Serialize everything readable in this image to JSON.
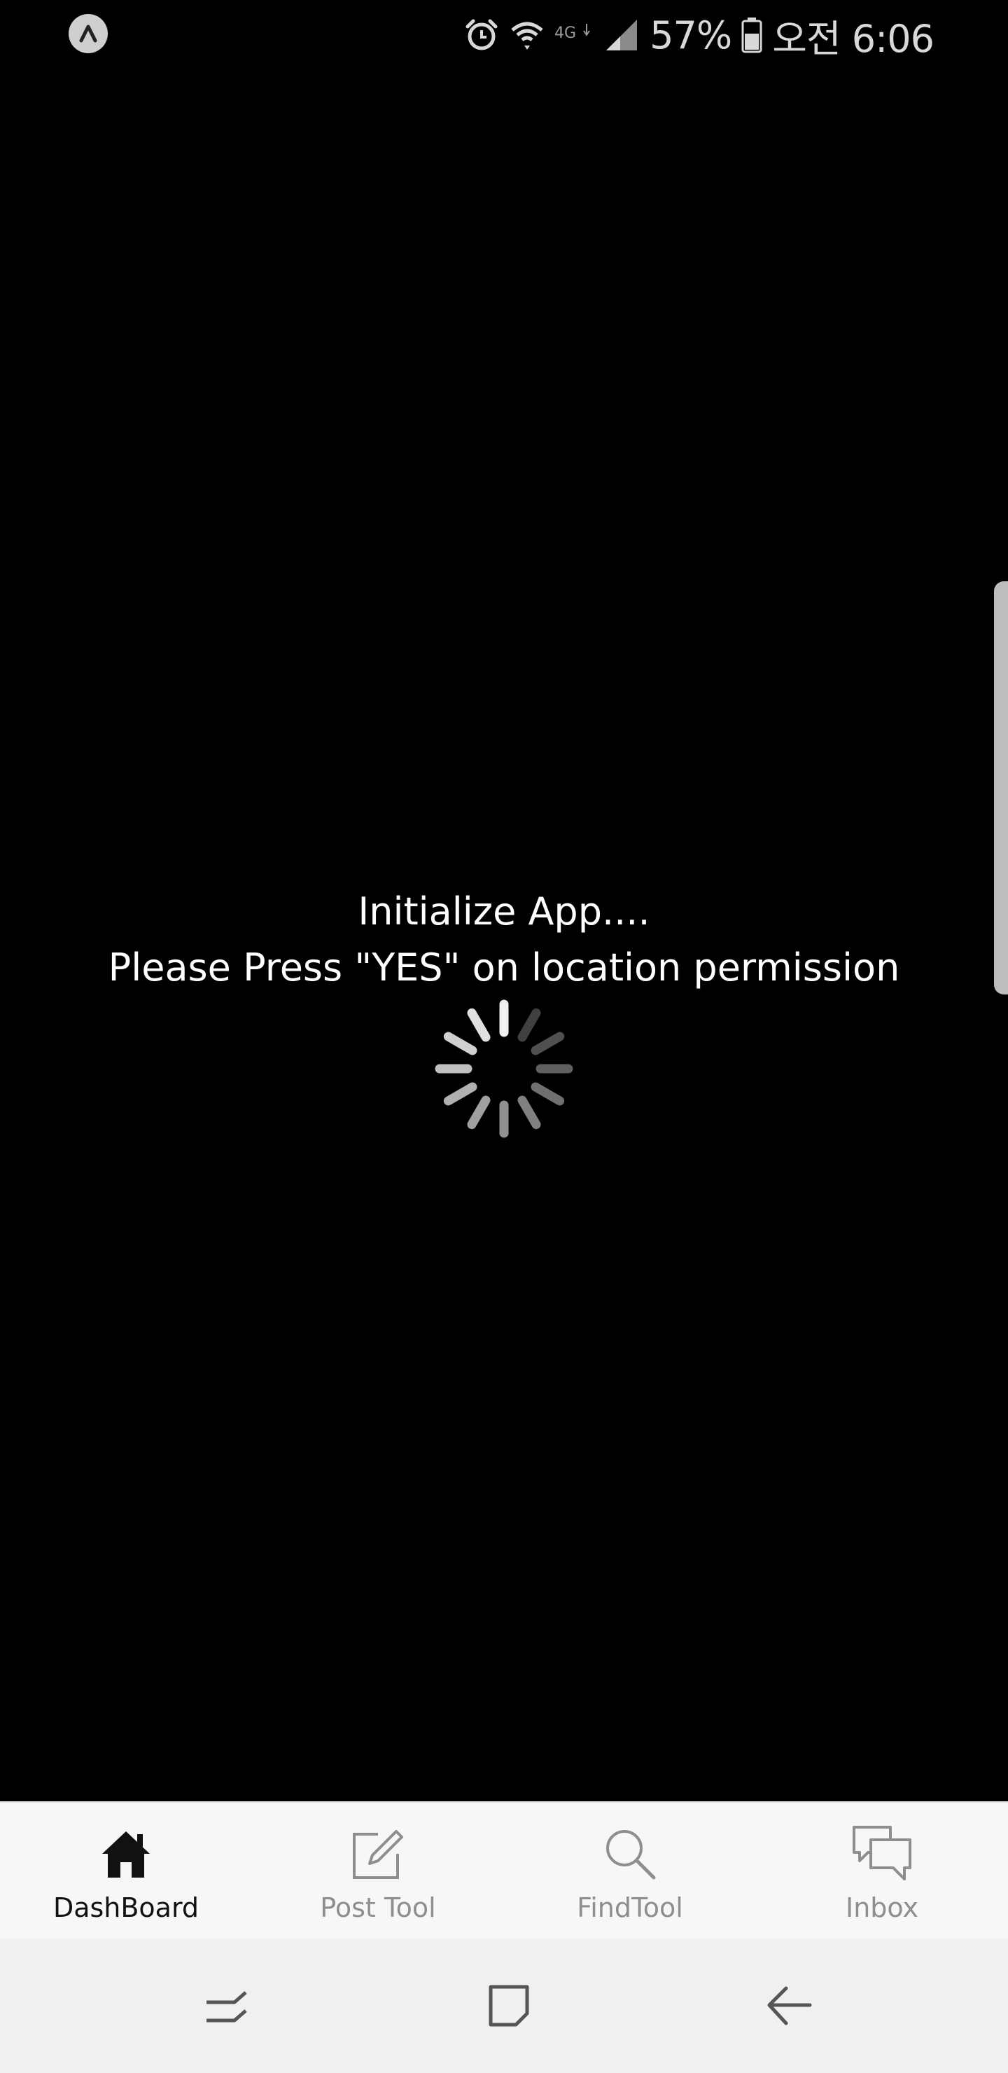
{
  "status_bar": {
    "battery_percent": "57%",
    "time": "오전 6:06",
    "network_label": "4G",
    "icons": [
      "app-notification-icon",
      "alarm-icon",
      "wifi-icon",
      "lte-icon",
      "signal-icon",
      "battery-icon"
    ]
  },
  "loading": {
    "line1": "Initialize App....",
    "line2": "Please Press \"YES\" on location permission"
  },
  "tabs": [
    {
      "label": "DashBoard",
      "icon": "home-icon",
      "active": true
    },
    {
      "label": "Post Tool",
      "icon": "edit-icon",
      "active": false
    },
    {
      "label": "FindTool",
      "icon": "search-icon",
      "active": false
    },
    {
      "label": "Inbox",
      "icon": "chat-icon",
      "active": false
    }
  ],
  "nav_bar": {
    "icons": [
      "recent-apps-icon",
      "home-square-icon",
      "back-icon"
    ]
  },
  "colors": {
    "background": "#000000",
    "tab_bar": "#f7f7f7",
    "tab_active": "#111111",
    "tab_inactive": "#8e8e8e",
    "nav_bar": "#f0f0f0"
  }
}
